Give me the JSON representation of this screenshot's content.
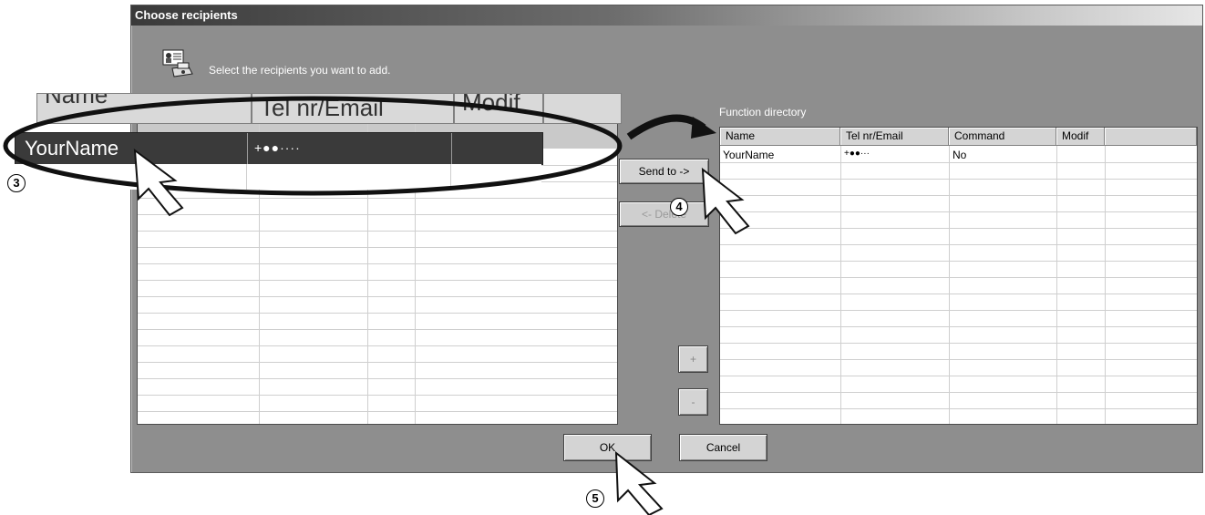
{
  "dialog": {
    "title": "Choose recipients",
    "instruction": "Select the recipients you want to add.",
    "icon": "recipients-fax-icon"
  },
  "left_list": {
    "zoom_columns": [
      "Name",
      "Tel nr/Email",
      "Modif"
    ],
    "rows": [
      {
        "name": "YourName",
        "tel": "+●●····",
        "modif": ""
      }
    ]
  },
  "right_list": {
    "caption": "Function directory",
    "columns": [
      "Name",
      "Tel nr/Email",
      "Command",
      "Modif"
    ],
    "rows": [
      {
        "name": "YourName",
        "tel": "+●●···",
        "command": "No",
        "modif": ""
      }
    ]
  },
  "buttons": {
    "send_to": "Send to ->",
    "delete": "<- Delete",
    "plus": "+",
    "minus": "-",
    "ok": "OK",
    "cancel": "Cancel"
  },
  "callouts": {
    "step3": "3",
    "step4": "4",
    "step5": "5"
  }
}
